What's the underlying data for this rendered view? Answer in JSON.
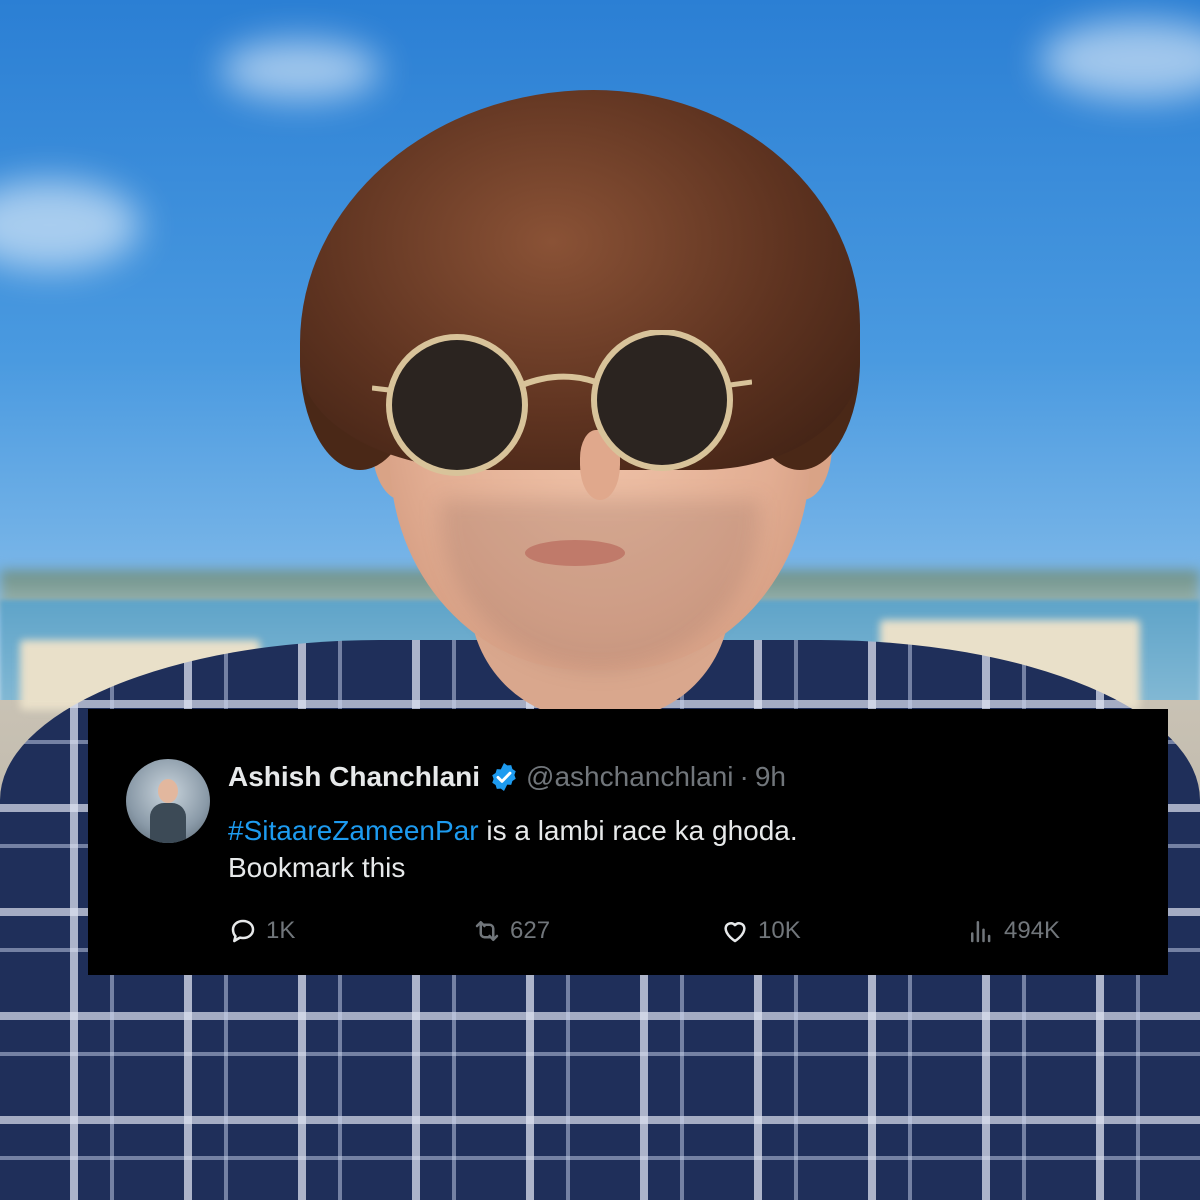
{
  "tweet": {
    "author_name": "Ashish Chanchlani",
    "verified": true,
    "handle": "@ashchanchlani",
    "separator": "·",
    "time": "9h",
    "hashtag": "#SitaareZameenPar",
    "text_rest": " is a lambi race ka ghoda.",
    "text_line2": "Bookmark this",
    "stats": {
      "replies": "1K",
      "reposts": "627",
      "likes": "10K",
      "views": "494K"
    }
  },
  "colors": {
    "tweet_bg": "#000000",
    "text": "#e7e9ea",
    "muted": "#71767b",
    "hashtag": "#1d9bf0",
    "verified_badge": "#1d9bf0"
  },
  "icons": {
    "reply": "speech-bubble-icon",
    "repost": "repost-arrows-icon",
    "like": "heart-icon",
    "views": "bar-chart-icon",
    "verified": "verified-badge-icon"
  }
}
